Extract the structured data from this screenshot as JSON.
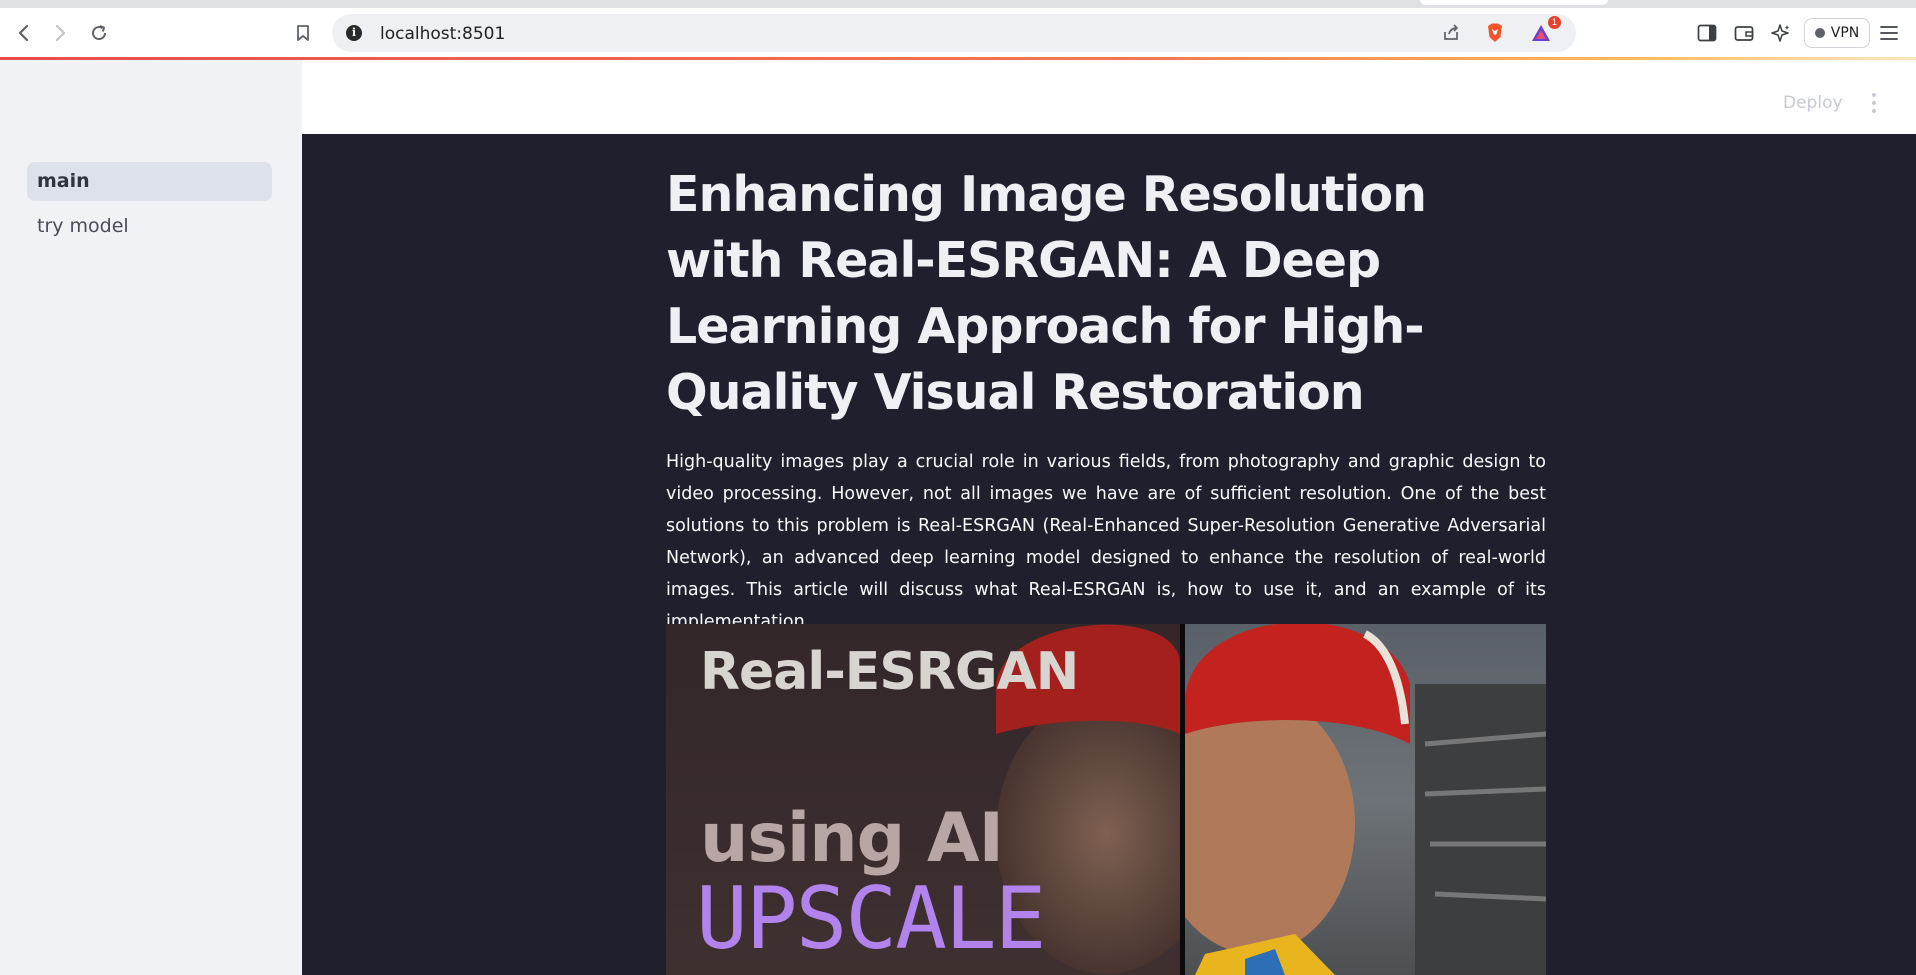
{
  "browser": {
    "url": "localhost:8501",
    "rewards_count": "1",
    "vpn_label": "VPN"
  },
  "sidebar": {
    "items": [
      {
        "label": "main",
        "active": true
      },
      {
        "label": "try model",
        "active": false
      }
    ]
  },
  "header": {
    "deploy_label": "Deploy"
  },
  "main": {
    "title": "Enhancing Image Resolution with Real-ESRGAN: A Deep Learning Approach for High-Quality Visual Restoration",
    "paragraph": "High-quality images play a crucial role in various fields, from photography and graphic design to video processing. However, not all images we have are of sufficient resolution. One of the best solutions to this problem is Real-ESRGAN (Real-Enhanced Super-Resolution Generative Adversarial Network), an advanced deep learning model designed to enhance the resolution of real-world images. This article will discuss what Real-ESRGAN is, how to use it, and an example of its implementation.",
    "hero": {
      "brand_text": "Real-ESRGAN",
      "using_text": "using AI",
      "upscale_text": "UPSCALE"
    }
  },
  "colors": {
    "main_bg": "#1f1f2e",
    "sidebar_bg": "#f0f2f6",
    "upscale_accent": "#b283ec"
  }
}
